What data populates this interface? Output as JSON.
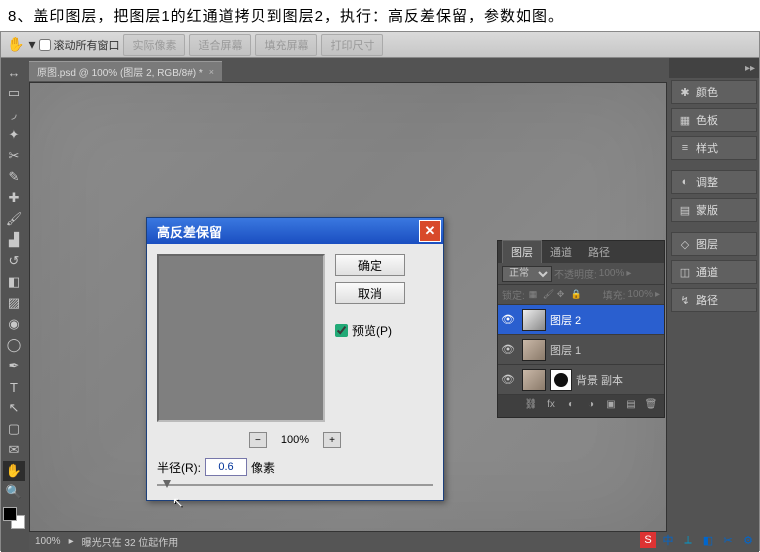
{
  "instruction": "8、盖印图层，把图层1的红通道拷贝到图层2，执行：高反差保留，参数如图。",
  "secondary": {
    "checkbox_label": "滚动所有窗口",
    "buttons": [
      "实际像素",
      "适合屏幕",
      "填充屏幕",
      "打印尺寸"
    ]
  },
  "doc_tab": {
    "title": "原图.psd @ 100% (图层 2, RGB/8#) *"
  },
  "status": {
    "zoom": "100%",
    "info": "曝光只在 32 位起作用"
  },
  "right_panels": [
    {
      "icon": "✱",
      "label": "颜色"
    },
    {
      "icon": "▦",
      "label": "色板"
    },
    {
      "icon": "≡",
      "label": "样式"
    },
    {
      "icon": "◐",
      "label": "调整"
    },
    {
      "icon": "▤",
      "label": "蒙版"
    },
    {
      "icon": "◇",
      "label": "图层"
    },
    {
      "icon": "◫",
      "label": "通道"
    },
    {
      "icon": "↯",
      "label": "路径"
    }
  ],
  "dialog": {
    "title": "高反差保留",
    "ok": "确定",
    "cancel": "取消",
    "preview_chk": "预览(P)",
    "zoom_pct": "100%",
    "radius_label": "半径(R):",
    "radius_value": "0.6",
    "radius_unit": "像素"
  },
  "layers_panel": {
    "tabs": [
      "图层",
      "通道",
      "路径"
    ],
    "blend_mode": "正常",
    "opacity_label": "不透明度:",
    "opacity_value": "100%",
    "lock_label": "锁定:",
    "fill_label": "填充:",
    "fill_value": "100%",
    "rows": [
      {
        "name": "图层 2",
        "selected": true
      },
      {
        "name": "图层 1",
        "selected": false
      },
      {
        "name": "背景 副本",
        "selected": false,
        "masked": true
      }
    ]
  },
  "taskbar": {
    "items": [
      "S",
      "中",
      "⟂",
      "◧",
      "✂",
      "⚙"
    ]
  }
}
